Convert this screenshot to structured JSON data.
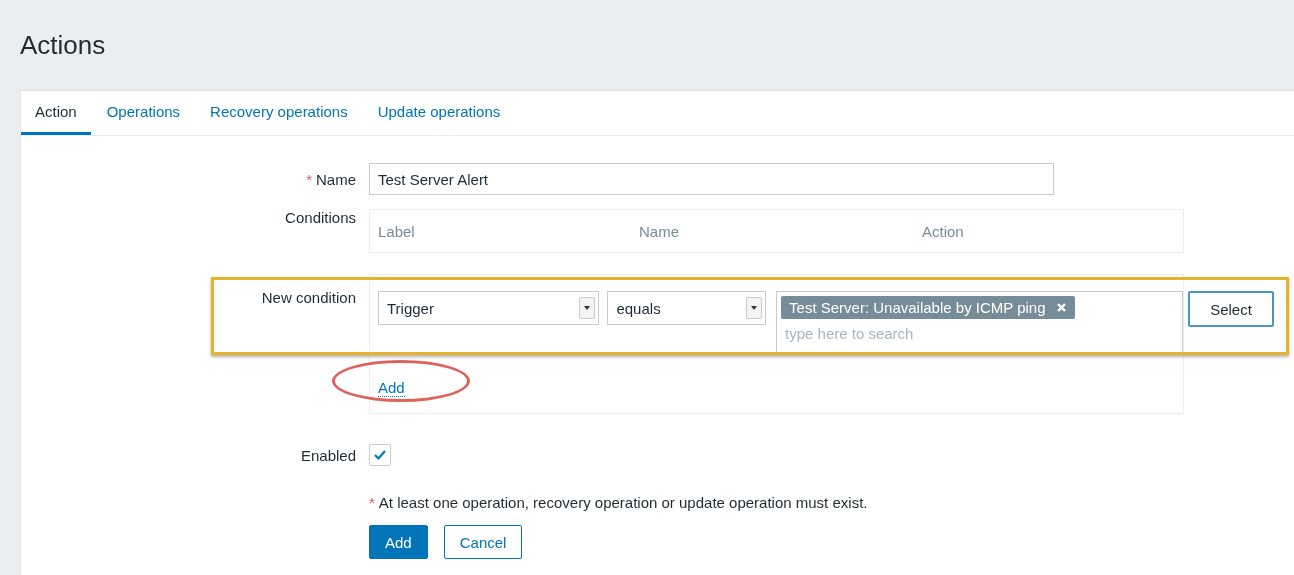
{
  "page_title": "Actions",
  "tabs": [
    {
      "label": "Action",
      "selected": true
    },
    {
      "label": "Operations",
      "selected": false
    },
    {
      "label": "Recovery operations",
      "selected": false
    },
    {
      "label": "Update operations",
      "selected": false
    }
  ],
  "form": {
    "name": {
      "label": "Name",
      "required_mark": "*",
      "value": "Test Server Alert"
    },
    "conditions": {
      "label": "Conditions",
      "columns": [
        "Label",
        "Name",
        "Action"
      ]
    },
    "new_condition": {
      "label": "New condition",
      "highlighted": true,
      "type_select": "Trigger",
      "operator_select": "equals",
      "tags": [
        "Test Server: Unavailable by ICMP ping"
      ],
      "search_placeholder": "type here to search",
      "select_button": "Select",
      "add_link": "Add",
      "add_circled": true
    },
    "enabled": {
      "label": "Enabled",
      "checked": true
    },
    "note": {
      "required_mark": "*",
      "text": "At least one operation, recovery operation or update operation must exist."
    },
    "buttons": [
      {
        "label": "Add",
        "kind": "primary"
      },
      {
        "label": "Cancel",
        "kind": "secondary"
      }
    ]
  }
}
